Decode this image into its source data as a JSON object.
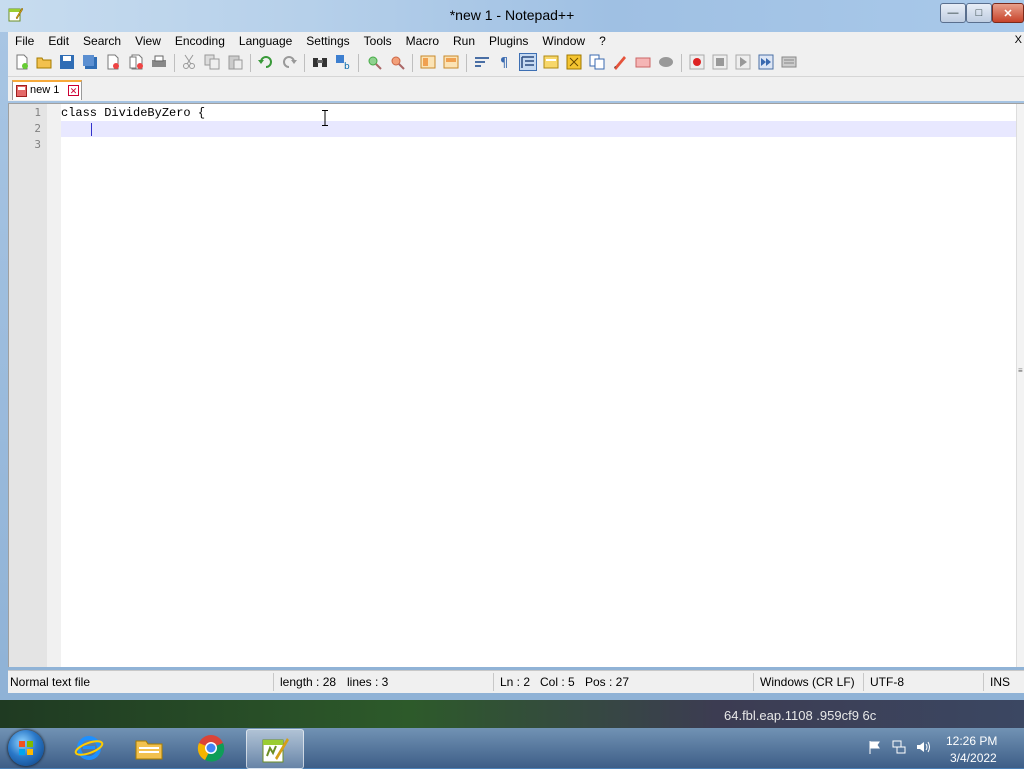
{
  "window": {
    "title": "*new 1 - Notepad++"
  },
  "title_buttons": {
    "minimize": "—",
    "maximize": "□",
    "close": "✕"
  },
  "menu": {
    "items": [
      "File",
      "Edit",
      "Search",
      "View",
      "Encoding",
      "Language",
      "Settings",
      "Tools",
      "Macro",
      "Run",
      "Plugins",
      "Window",
      "?"
    ],
    "close_glyph": "X"
  },
  "toolbar": {
    "buttons": [
      "new-file",
      "open-file",
      "save",
      "save-all",
      "close",
      "close-all",
      "print",
      "cut",
      "copy",
      "paste",
      "undo",
      "redo",
      "find",
      "replace",
      "zoom-in",
      "zoom-out",
      "sync-vertical",
      "sync-horizontal",
      "word-wrap",
      "show-all-chars",
      "indent-guide",
      "user-defined-language",
      "doc-map",
      "function-list",
      "folder-as-workspace",
      "monitoring",
      "record-macro",
      "stop-recording",
      "playback-macro",
      "run-macro-multiple",
      "save-macro"
    ]
  },
  "tabs": [
    {
      "label": "new 1",
      "modified": true
    }
  ],
  "editor": {
    "lines": [
      "1",
      "2",
      "3"
    ],
    "code": [
      "class DivideByZero {",
      "",
      ""
    ],
    "current_line": 2
  },
  "statusbar": {
    "type": "Normal text file",
    "length": "length : 28",
    "lines": "lines : 3",
    "ln": "Ln : 2",
    "col": "Col : 5",
    "pos": "Pos : 27",
    "eol": "Windows (CR LF)",
    "encoding": "UTF-8",
    "mode": "INS"
  },
  "desktop": {
    "wallpaper_text": "64.fbl.eap.1108 .959cf9 6c"
  },
  "taskbar": {
    "apps": [
      "internet-explorer",
      "file-explorer",
      "chrome",
      "notepad-plus-plus"
    ],
    "active_app": "notepad-plus-plus",
    "time": "12:26 PM",
    "date": "3/4/2022"
  },
  "colors": {
    "current_line": "#e8e8ff",
    "caret": "#3333cc",
    "tab_accent": "#f6a93a"
  }
}
